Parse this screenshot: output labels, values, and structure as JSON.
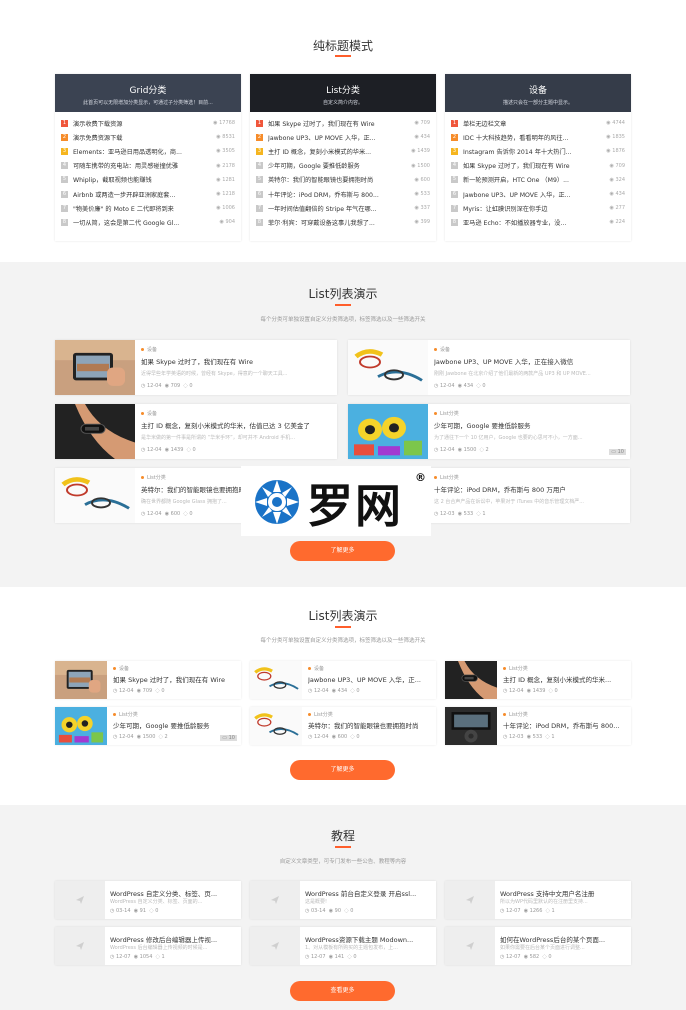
{
  "section1": {
    "title": "纯标题模式",
    "columns": [
      {
        "head_title": "Grid分类",
        "head_sub": "此首页可以无限增加分类显示，可通过子分类筛选！目前...",
        "items": [
          {
            "title": "演示收费下载资源",
            "views": "17768"
          },
          {
            "title": "演示免费资源下载",
            "views": "8531"
          },
          {
            "title": "Elements：亚马逊日用品透明化，商...",
            "views": "3505"
          },
          {
            "title": "可随车携带的充电站：用灵感碰撞优雅",
            "views": "2178"
          },
          {
            "title": "Whiplip，截取视频也能赚钱",
            "views": "1281"
          },
          {
            "title": "Airbnb 或两造一步开辟亚洲家庭套...",
            "views": "1218"
          },
          {
            "title": "\"物美价廉\" 的 Moto E 二代即将到来",
            "views": "1006"
          },
          {
            "title": "一切从简，这会是第二代 Google Gl...",
            "views": "904"
          }
        ]
      },
      {
        "head_title": "List分类",
        "head_sub": "自定义简介内容。",
        "items": [
          {
            "title": "如果 Skype 过时了，我们现在有 Wire",
            "views": "709"
          },
          {
            "title": "Jawbone UP3、UP MOVE 入华，正...",
            "views": "434"
          },
          {
            "title": "主打 ID 概念，复刻小米模式的华米...",
            "views": "1439"
          },
          {
            "title": "少年可期，Google 要推低龄服务",
            "views": "1500"
          },
          {
            "title": "英特尔：我们的智能眼镜也要拥抱时尚",
            "views": "600"
          },
          {
            "title": "十年评论：iPod DRM，乔布斯与 800...",
            "views": "533"
          },
          {
            "title": "一年时间估值翻倍的 Stripe 年气在哪...",
            "views": "337"
          },
          {
            "title": "菲尔·利宾：可穿戴设备这事儿我想了...",
            "views": "399"
          }
        ]
      },
      {
        "head_title": "设备",
        "head_sub": "描述只会在一部分主题中显示。",
        "items": [
          {
            "title": "单栏无边栏文章",
            "views": "4744"
          },
          {
            "title": "IDC 十大科技趋势，看看明年的风往...",
            "views": "1835"
          },
          {
            "title": "Instagram 告诉你 2014 年十大热门...",
            "views": "1876"
          },
          {
            "title": "如果 Skype 过时了，我们现在有 Wire",
            "views": "709"
          },
          {
            "title": "新一轮预测开启，HTC One （M9）...",
            "views": "324"
          },
          {
            "title": "Jawbone UP3、UP MOVE 入华，正...",
            "views": "434"
          },
          {
            "title": "Myris：让虹膜识别深在你手边",
            "views": "277"
          },
          {
            "title": "亚马逊 Echo：不如播放器专业，没...",
            "views": "224"
          }
        ]
      }
    ]
  },
  "section2": {
    "title": "List列表演示",
    "subtitle": "每个分类可单独设置自定义分类筛选项，标签筛选以及一些筛选开关",
    "cards": [
      {
        "cat": "设备",
        "title": "如果 Skype 过时了，我们现在有 Wire",
        "desc": "近得早些年学英语的时候，曾经有 Skype，得意的一个聊天工具...",
        "date": "12-04",
        "views": "709",
        "comments": "0",
        "badge": ""
      },
      {
        "cat": "设备",
        "title": "Jawbone UP3、UP MOVE 入华，正在接入微信",
        "desc": "刚刚 Jawbone 在北京介绍了他们最新的两款产品 UP3 和 UP MOVE...",
        "date": "12-04",
        "views": "434",
        "comments": "0",
        "badge": ""
      },
      {
        "cat": "设备",
        "title": "主打 ID 概念，复刻小米模式的华米，估值已达 3 亿美金了",
        "desc": "是华米做的第一件事是所谓的 “华米手环”，却可并不 Android 手机...",
        "date": "12-04",
        "views": "1439",
        "comments": "0",
        "badge": ""
      },
      {
        "cat": "List分类",
        "title": "少年可期，Google 要推低龄服务",
        "desc": "为了通往下一个 10 亿用户，Google 也要的心思可不小，一方面...",
        "date": "12-04",
        "views": "1500",
        "comments": "2",
        "badge": "10"
      },
      {
        "cat": "List分类",
        "title": "英特尔：我们的智能眼镜也要拥抱时尚",
        "desc": "确在世界都随 Google Glass 拥抱了...",
        "date": "12-04",
        "views": "600",
        "comments": "0",
        "badge": ""
      },
      {
        "cat": "List分类",
        "title": "十年评论：iPod DRM，乔布斯与 800 万用户",
        "desc": "这 2 台合声产品在诉讼中，苹果对于 iTunes 中的音乐管理文档严...",
        "date": "12-03",
        "views": "533",
        "comments": "1",
        "badge": ""
      }
    ],
    "button": "了解更多"
  },
  "section3": {
    "title": "List列表演示",
    "subtitle": "每个分类可单独设置自定义分类筛选项，标签筛选以及一些筛选开关",
    "cards": [
      {
        "cat": "设备",
        "title": "如果 Skype 过时了，我们现在有 Wire",
        "date": "12-04",
        "views": "709",
        "comments": "0",
        "badge": ""
      },
      {
        "cat": "设备",
        "title": "Jawbone UP3、UP MOVE 入华，正...",
        "date": "12-04",
        "views": "434",
        "comments": "0",
        "badge": ""
      },
      {
        "cat": "List分类",
        "title": "主打 ID 概念，复刻小米模式的华米...",
        "date": "12-04",
        "views": "1439",
        "comments": "0",
        "badge": ""
      },
      {
        "cat": "List分类",
        "title": "少年可期，Google 要推低龄服务",
        "date": "12-04",
        "views": "1500",
        "comments": "2",
        "badge": "10"
      },
      {
        "cat": "List分类",
        "title": "英特尔：我们的智能眼镜也要拥抱时尚",
        "date": "12-04",
        "views": "600",
        "comments": "0",
        "badge": ""
      },
      {
        "cat": "List分类",
        "title": "十年评论：iPod DRM，乔布斯与 800...",
        "date": "12-03",
        "views": "533",
        "comments": "1",
        "badge": ""
      }
    ],
    "button": "了解更多"
  },
  "section4": {
    "title": "教程",
    "subtitle": "自定义文章类型，可专门发布一些公告、教程等内容",
    "cards": [
      {
        "title": "WordPress 自定义分类、标签、页...",
        "desc": "WordPress 自定义分类、标签、页面的...",
        "date": "03-14",
        "views": "91",
        "comments": "0"
      },
      {
        "title": "WordPress 前台自定义登录 开启ssl...",
        "desc": "这是概要!",
        "date": "03-14",
        "views": "90",
        "comments": "0"
      },
      {
        "title": "WordPress 支持中文用户名注册",
        "desc": "所以为WP代码里默认的在注册里支持...",
        "date": "12-07",
        "views": "1266",
        "comments": "1"
      },
      {
        "title": "WordPress 修改后台编辑器上传视...",
        "desc": "WordPress 后台编辑器上传视频的时候是...",
        "date": "12-07",
        "views": "1054",
        "comments": "1"
      },
      {
        "title": "WordPress资源下载主题 Modown...",
        "desc": "1、对从模板有所购买的主题包发布，上...",
        "date": "12-07",
        "views": "141",
        "comments": "0"
      },
      {
        "title": "如何在WordPress后台的某个页面...",
        "desc": "如果你需要在后台某个页面进行调整...",
        "date": "12-07",
        "views": "582",
        "comments": "0"
      }
    ],
    "button": "查看更多"
  },
  "watermark": {
    "text": "罗网",
    "mark": "®"
  }
}
